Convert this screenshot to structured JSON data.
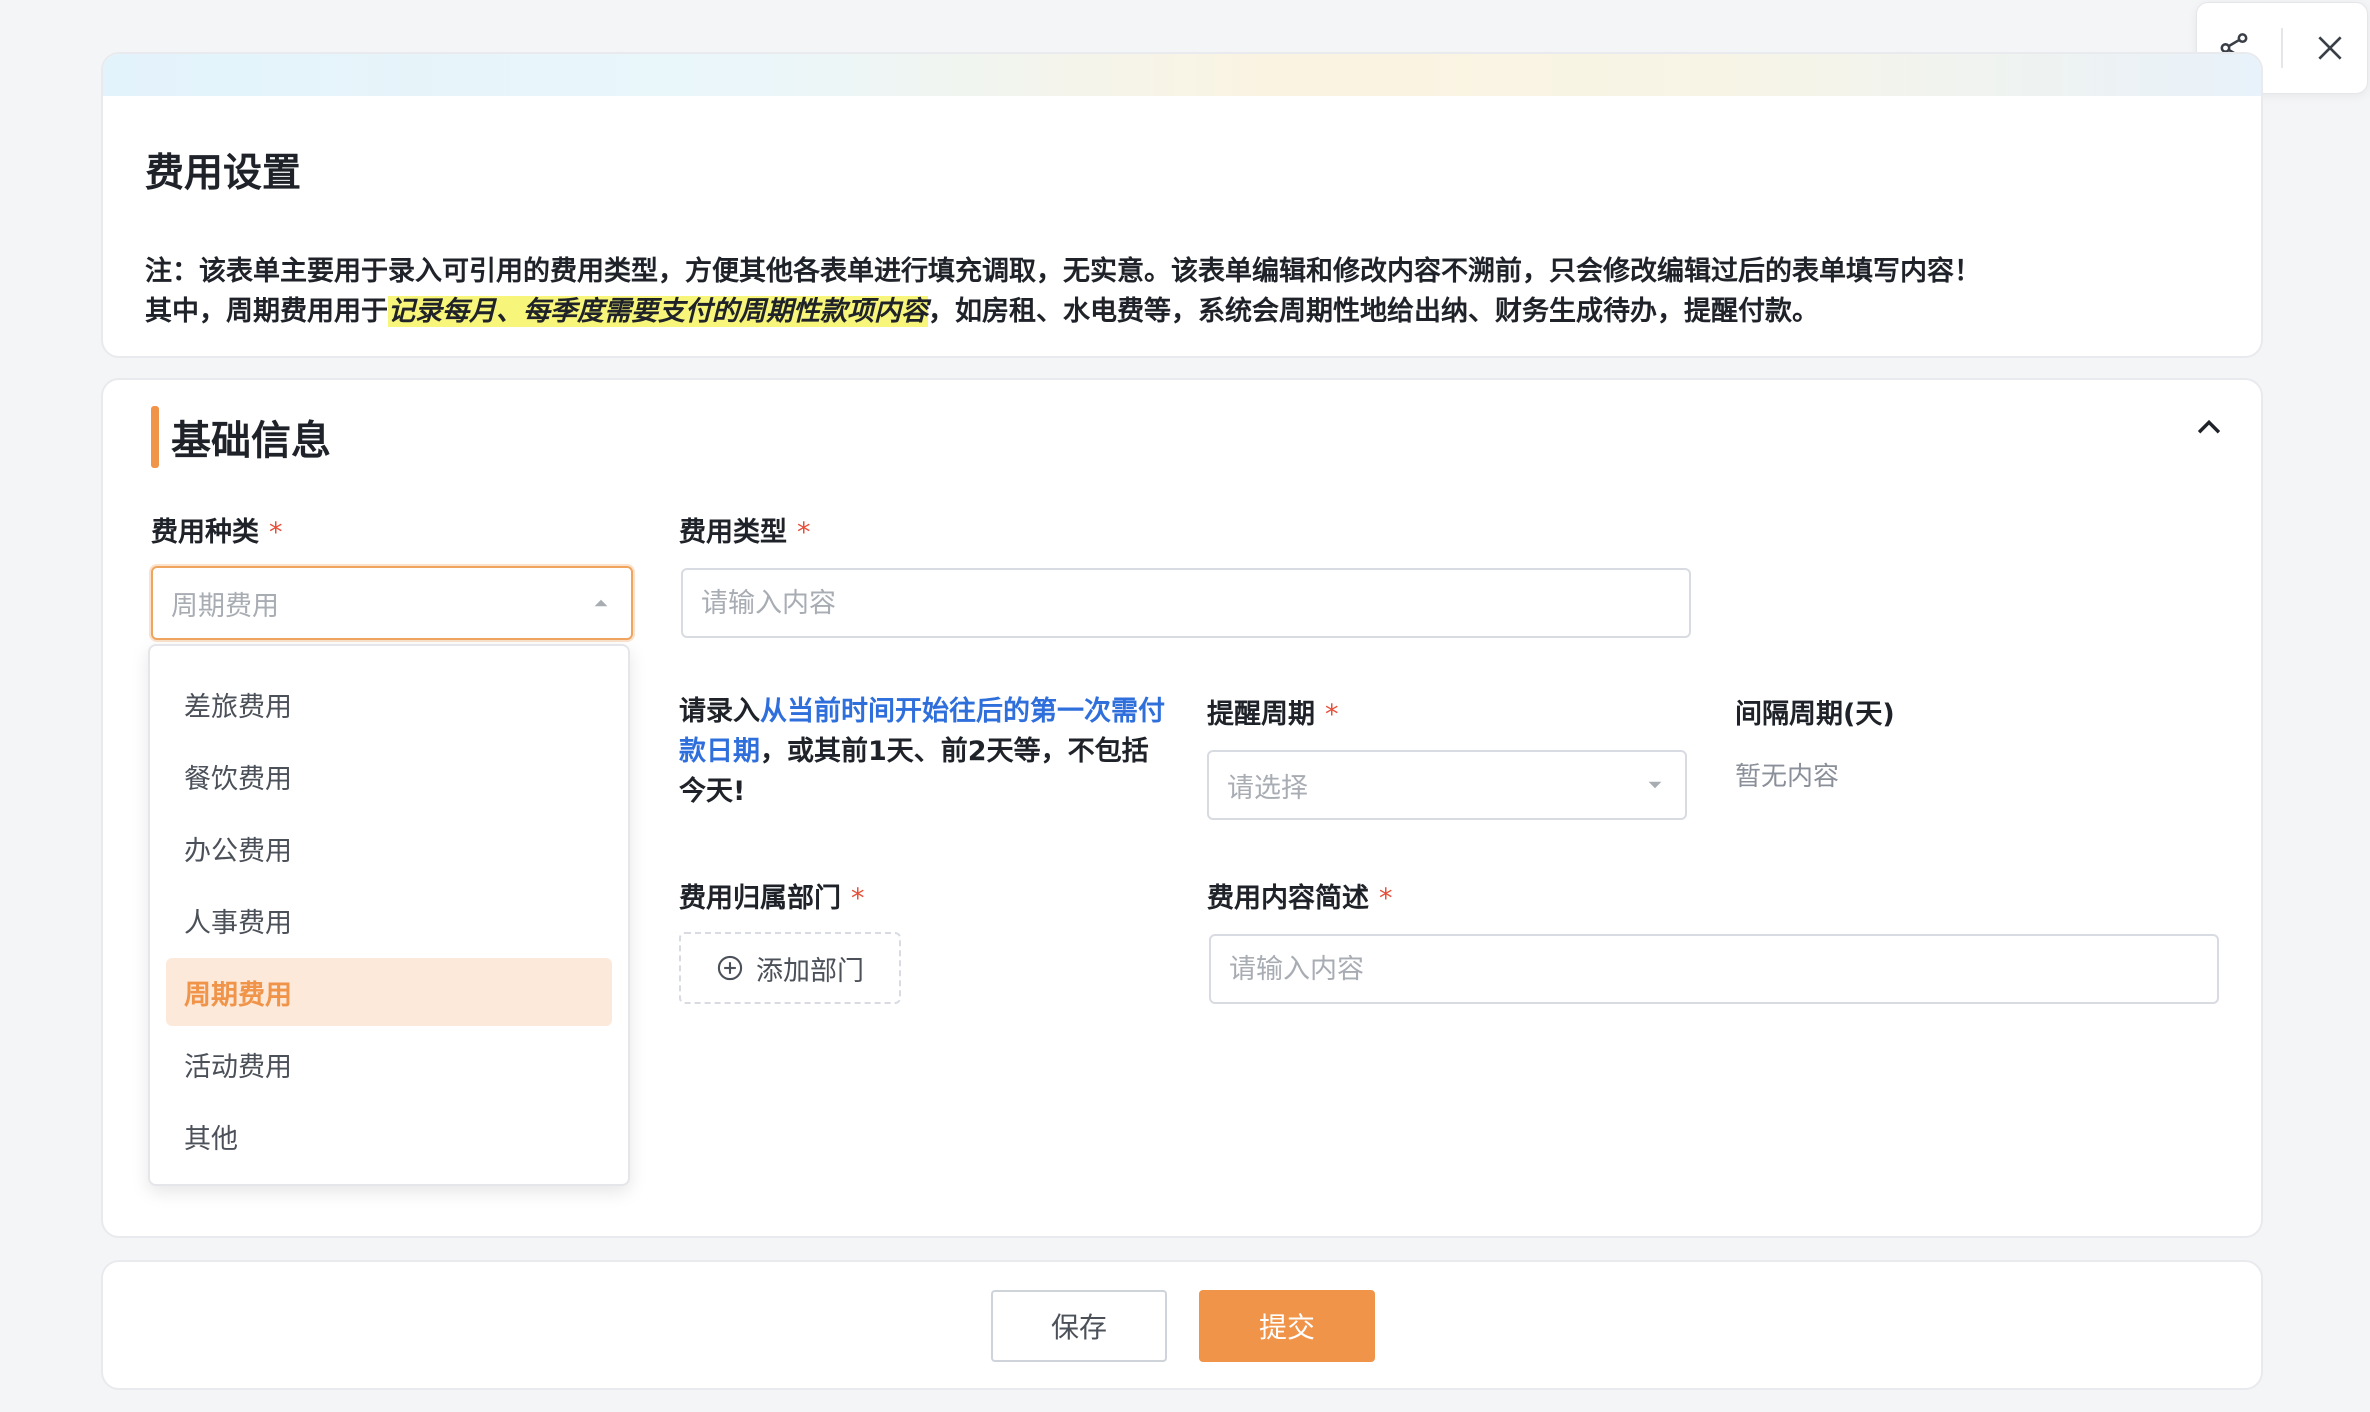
{
  "header": {
    "title": "费用设置",
    "note_line1": "注：该表单主要用于录入可引用的费用类型，方便其他各表单进行填充调取，无实意。该表单编辑和修改内容不溯前，只会修改编辑过后的表单填写内容！",
    "note_line2_prefix": "其中，周期费用用于",
    "note_line2_highlight": "记录每月、每季度需要支付的周期性款项内容",
    "note_line2_suffix": "，如房租、水电费等，系统会周期性地给出纳、财务生成待办，提醒付款。"
  },
  "section": {
    "title": "基础信息"
  },
  "fields": {
    "category": {
      "label": "费用种类",
      "required_mark": "*",
      "value": "周期费用"
    },
    "type": {
      "label": "费用类型",
      "required_mark": "*",
      "placeholder": "请输入内容"
    },
    "hint": {
      "prefix": "请录入",
      "highlight": "从当前时间开始往后的第一次需付款日期",
      "suffix": "，或其前1天、前2天等，不包括今天!"
    },
    "remind_cycle": {
      "label": "提醒周期",
      "required_mark": "*",
      "placeholder": "请选择"
    },
    "interval": {
      "label": "间隔周期(天)",
      "value": "暂无内容"
    },
    "department": {
      "label": "费用归属部门",
      "required_mark": "*",
      "button": "添加部门"
    },
    "description": {
      "label": "费用内容简述",
      "required_mark": "*",
      "placeholder": "请输入内容"
    }
  },
  "dropdown": {
    "options": [
      "差旅费用",
      "餐饮费用",
      "办公费用",
      "人事费用",
      "周期费用",
      "活动费用",
      "其他"
    ],
    "selected": "周期费用"
  },
  "footer": {
    "save_label": "保存",
    "submit_label": "提交"
  },
  "colors": {
    "accent": "#f0944a",
    "link_blue": "#2f6fdc",
    "required_red": "#e5503a",
    "highlight_yellow": "#f7f57a"
  },
  "icons": {
    "share": "share-icon",
    "close": "close-icon",
    "collapse": "chevron-up-icon",
    "select_open": "caret-up-icon",
    "select_closed": "caret-down-icon",
    "add": "plus-circle-icon"
  }
}
